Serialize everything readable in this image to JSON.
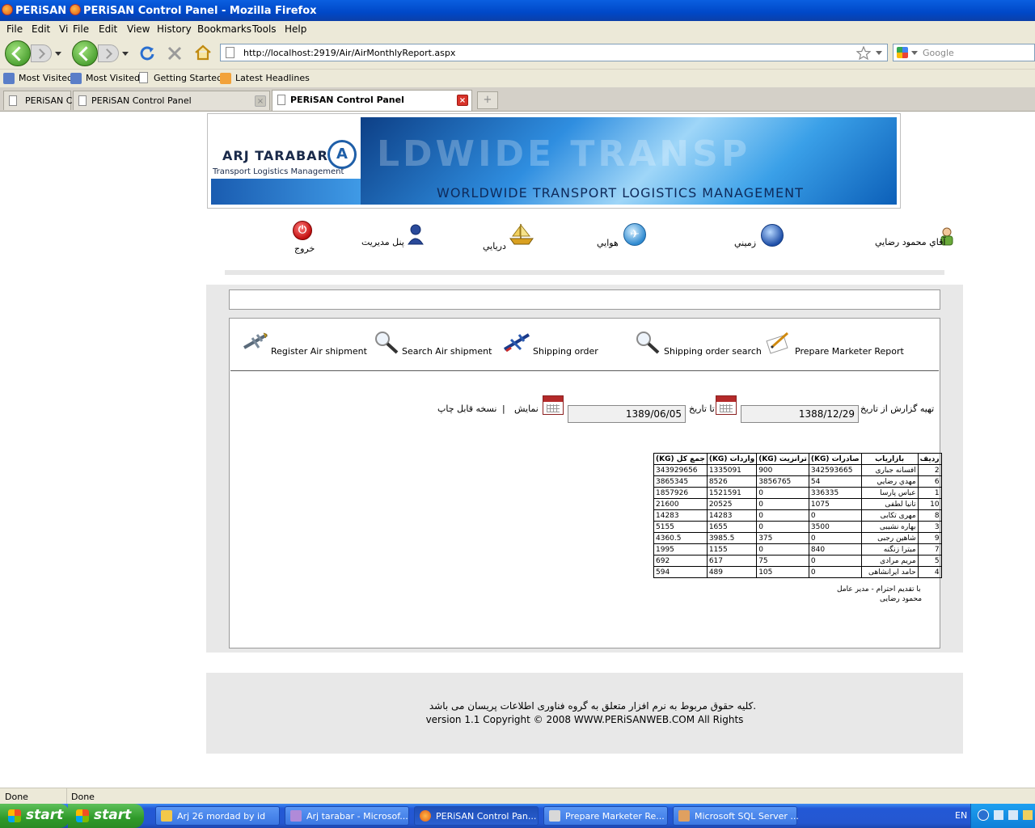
{
  "window": {
    "title_prev": "PERiSAN C",
    "title": "PERiSAN Control Panel - Mozilla Firefox"
  },
  "menu": {
    "file1": "File",
    "edit1": "Edit",
    "view_trunc": "Vi",
    "file": "File",
    "edit": "Edit",
    "view": "View",
    "history": "History",
    "bookmarks": "Bookmarks",
    "tools": "Tools",
    "help": "Help"
  },
  "nav": {
    "url": "http://localhost:2919/Air/AirMonthlyReport.aspx",
    "search_placeholder": "Google"
  },
  "bookmarks": [
    "Most Visited",
    "Most Visited",
    "Getting Started",
    "Latest Headlines"
  ],
  "tabs": [
    {
      "label": "PERiSAN C"
    },
    {
      "label": "PERiSAN Control Panel"
    },
    {
      "label": "PERiSAN Control Panel"
    }
  ],
  "banner": {
    "company": "ARJ TARABAR",
    "company_sub": "Transport Logistics Management",
    "slogan": "WORLDWIDE TRANSPORT LOGISTICS MANAGEMENT",
    "ghost_text": "LDWIDE TRANSP"
  },
  "topnav": {
    "user": "آقاي محمود رضايي",
    "land": "زميني",
    "air": "هوايي",
    "sea": "دريايي",
    "admin": "پنل مديريت",
    "logout": "خروج"
  },
  "tools": {
    "register": "Register Air shipment",
    "search": "Search Air shipment",
    "shipping_order": "Shipping order",
    "shipping_search": "Shipping order search",
    "marketer_report": "Prepare Marketer Report"
  },
  "report_form": {
    "from_label": "تهيه گزارش از تاريخ",
    "from_date": "1388/12/29",
    "to_label": "تا تاريخ",
    "to_date": "1389/06/05",
    "show": "نمايش",
    "separator": "|",
    "printable": "نسخه قابل چاپ"
  },
  "report_table": {
    "headers": [
      "رديف",
      "بازارياب",
      "صادرات (KG)",
      "ترانزيت (KG)",
      "واردات (KG)",
      "جمع كل (KG)"
    ],
    "rows": [
      [
        "2",
        "افسانه جباری",
        "342593665",
        "900",
        "1335091",
        "343929656"
      ],
      [
        "6",
        "مهدي رضايي",
        "54",
        "3856765",
        "8526",
        "3865345"
      ],
      [
        "1",
        "عباس پارسا",
        "336335",
        "0",
        "1521591",
        "1857926"
      ],
      [
        "10",
        "تانيا لطفی",
        "1075",
        "0",
        "20525",
        "21600"
      ],
      [
        "8",
        "مهری تكابی",
        "0",
        "0",
        "14283",
        "14283"
      ],
      [
        "3",
        "بهاره نشيبی",
        "3500",
        "0",
        "1655",
        "5155"
      ],
      [
        "9",
        "شاهين رجبی",
        "0",
        "375",
        "3985.5",
        "4360.5"
      ],
      [
        "7",
        "ميترا زنگنه",
        "840",
        "0",
        "1155",
        "1995"
      ],
      [
        "5",
        "مريم مرادی",
        "0",
        "75",
        "617",
        "692"
      ],
      [
        "4",
        "حامد ايرانشاهی",
        "0",
        "105",
        "489",
        "594"
      ]
    ]
  },
  "signature": {
    "line1": "با تقديم احترام - مدير عامل",
    "line2": "محمود رضايی"
  },
  "footer": {
    "rights_fa": "كليه حقوق مربوط به نرم افزار متعلق به گروه فناوری اطلاعات پريسان می باشد.",
    "version": "version 1.1  Copyright © 2008 WWW.PERiSANWEB.COM All Rights"
  },
  "status": {
    "left": "Done",
    "right": "Done"
  },
  "taskbar": {
    "start1": "start",
    "start2": "start",
    "tasks": [
      "Arj 26 mordad by id",
      "Arj tarabar - Microsof...",
      "PERiSAN Control Pan...",
      "Prepare Marketer Re...",
      "Microsoft SQL Server ..."
    ],
    "lang": "EN"
  }
}
